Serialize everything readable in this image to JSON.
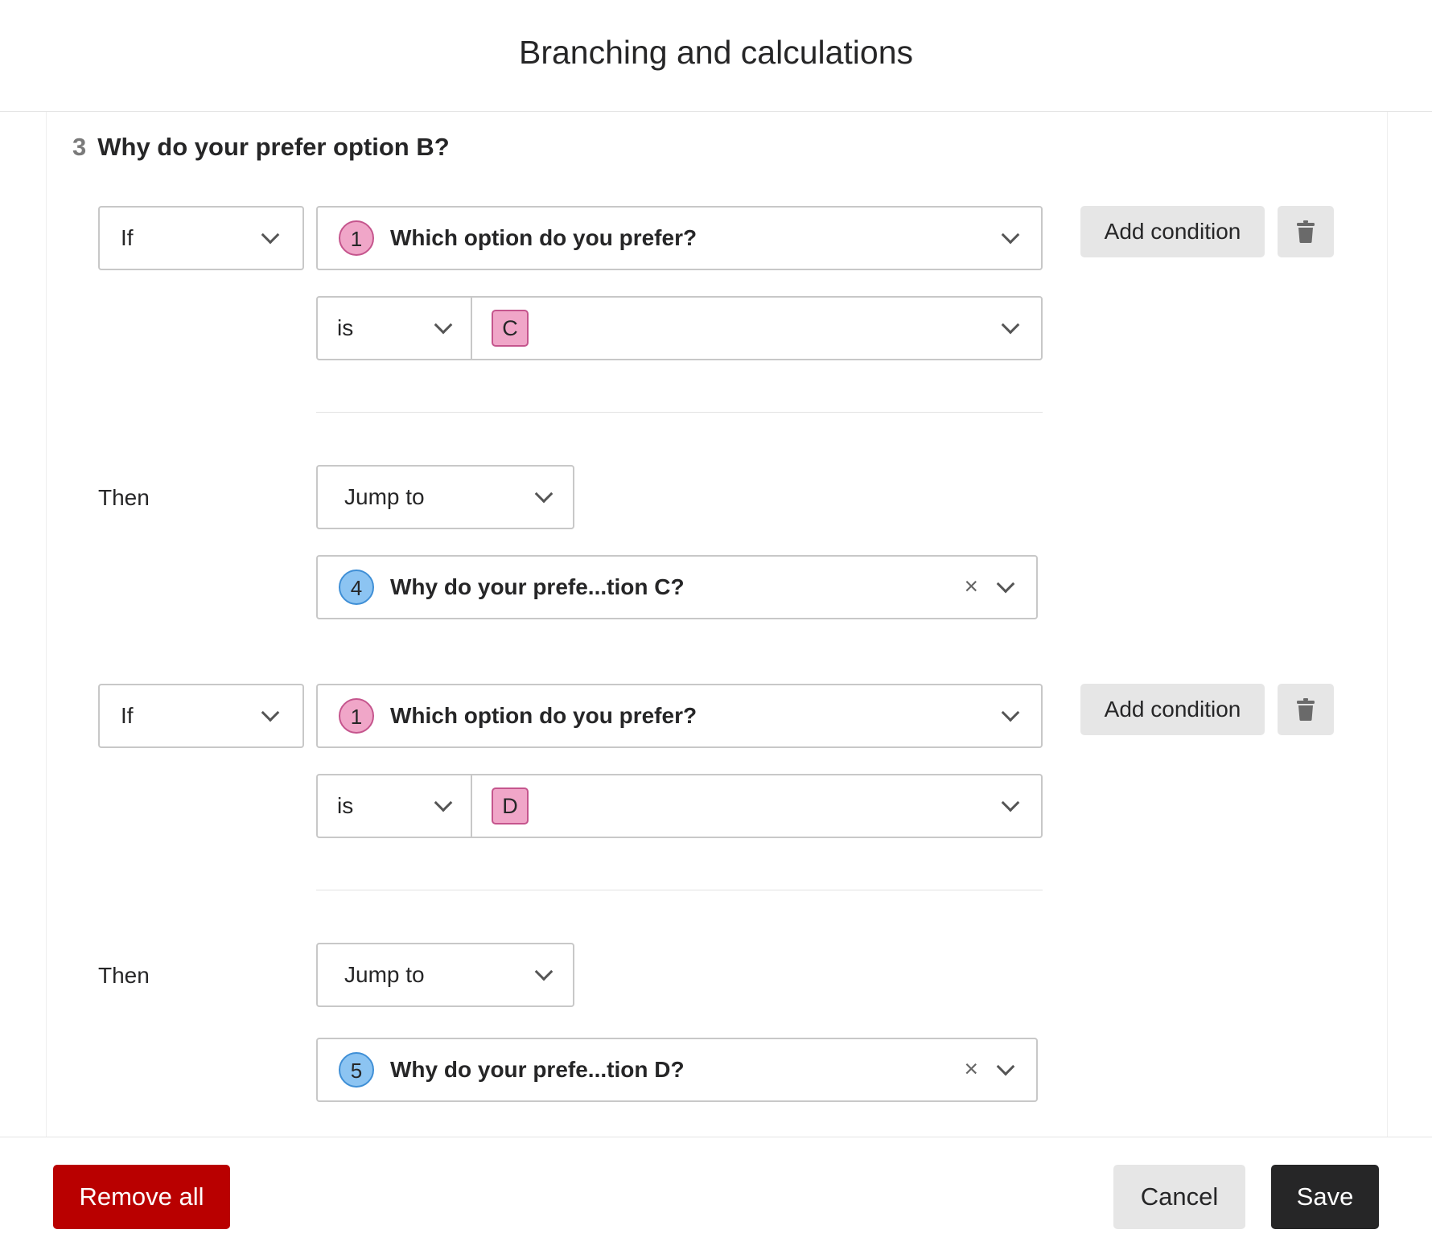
{
  "header": {
    "title": "Branching and calculations"
  },
  "question": {
    "number": "3",
    "title": "Why do your prefer option B?"
  },
  "rules": [
    {
      "if_label": "If",
      "source_question": {
        "number": "1",
        "text": "Which option do you prefer?"
      },
      "operator": "is",
      "value": "C",
      "then_label": "Then",
      "action": "Jump to",
      "target_question": {
        "number": "4",
        "text": "Why do your prefe...tion C?"
      },
      "add_condition_label": "Add condition"
    },
    {
      "if_label": "If",
      "source_question": {
        "number": "1",
        "text": "Which option do you prefer?"
      },
      "operator": "is",
      "value": "D",
      "then_label": "Then",
      "action": "Jump to",
      "target_question": {
        "number": "5",
        "text": "Why do your prefe...tion D?"
      },
      "add_condition_label": "Add condition"
    }
  ],
  "footer": {
    "remove_all_label": "Remove all",
    "cancel_label": "Cancel",
    "save_label": "Save"
  },
  "colors": {
    "remove": "#b90000",
    "save": "#262627",
    "choice_pink": "#f0a6c8",
    "question_blue": "#8cc4f2"
  },
  "icons": {
    "delete": "trash-icon",
    "dropdown": "chevron-down-icon",
    "clear": "close-icon"
  }
}
